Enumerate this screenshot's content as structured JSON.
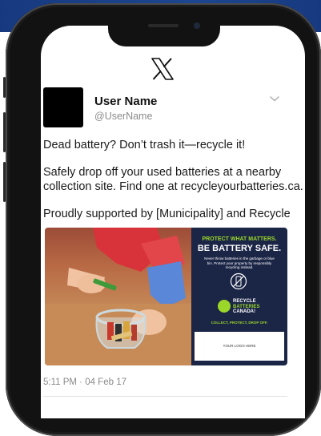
{
  "app": {
    "logo_icon": "x-logo-icon"
  },
  "tweet": {
    "user_name": "User Name",
    "handle": "@UserName",
    "paragraphs": [
      "Dead battery? Don’t trash it—recycle it!",
      "Safely drop off your used batteries at a nearby",
      "collection site. Find one at recycleyourbatteries.ca.",
      "Proudly supported by [Municipality] and Recycle"
    ],
    "timestamp": "5:11 PM · 04 Feb 17"
  },
  "ad": {
    "headline_small": "PROTECT WHAT MATTERS.",
    "headline_large": "BE BATTERY SAFE.",
    "body": "Never throw batteries in the garbage or blue bin. Protect your property by responsibly recycling instead.",
    "brand_line1": "RECYCLE",
    "brand_line2": "BATTERIES",
    "brand_line3": "CANADA!",
    "tagline": "COLLECT, PROTECT, DROP OFF.",
    "logo_placeholder": "YOUR LOGO HERE"
  },
  "colors": {
    "banner": "#1c4690",
    "ad_background": "#1b2546",
    "ad_accent": "#9bd62a"
  }
}
